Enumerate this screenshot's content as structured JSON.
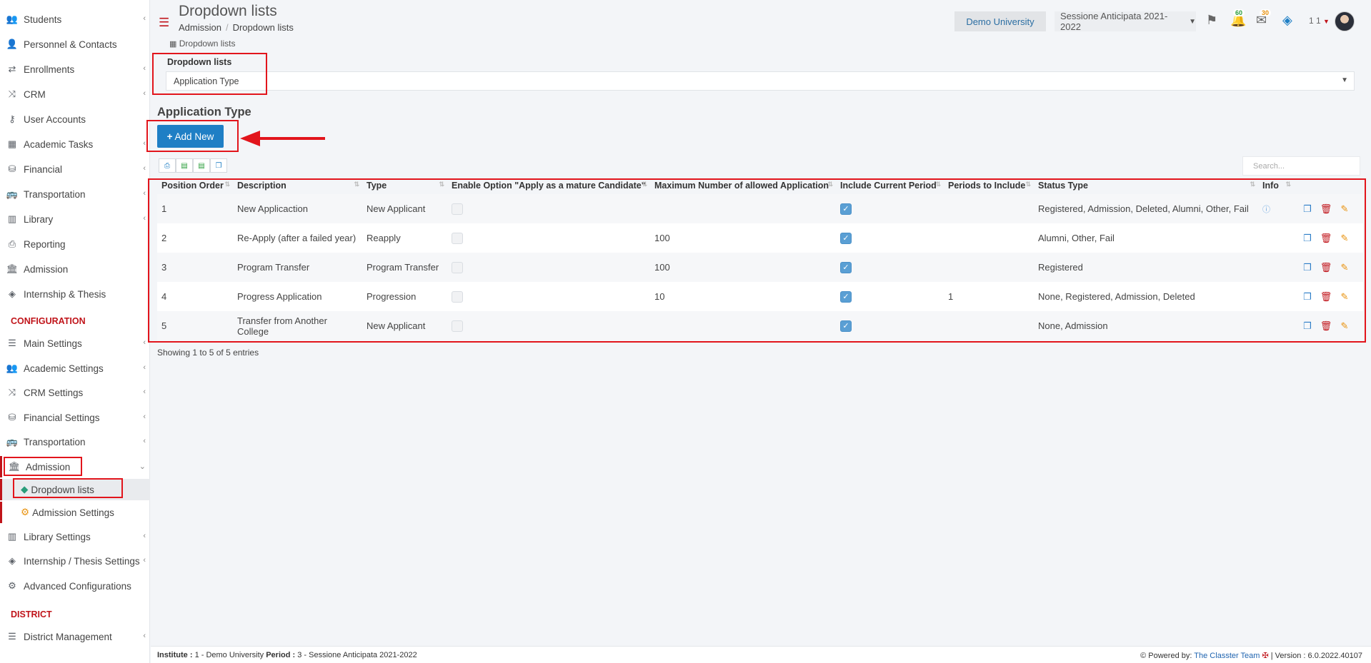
{
  "sidebar": {
    "items": [
      {
        "label": "Students",
        "icon": "students-icon",
        "glyph": "👥"
      },
      {
        "label": "Personnel & Contacts",
        "icon": "personnel-icon",
        "glyph": "👤"
      },
      {
        "label": "Enrollments",
        "icon": "exchange-icon",
        "glyph": "⇄"
      },
      {
        "label": "CRM",
        "icon": "random-icon",
        "glyph": "⤨"
      },
      {
        "label": "User Accounts",
        "icon": "key-icon",
        "glyph": "⚷"
      },
      {
        "label": "Academic Tasks",
        "icon": "grid-icon",
        "glyph": "▦"
      },
      {
        "label": "Financial",
        "icon": "coins-icon",
        "glyph": "⛁"
      },
      {
        "label": "Transportation",
        "icon": "bus-icon",
        "glyph": "🚌"
      },
      {
        "label": "Library",
        "icon": "books-icon",
        "glyph": "▥"
      },
      {
        "label": "Reporting",
        "icon": "print-icon",
        "glyph": "⎙"
      },
      {
        "label": "Admission",
        "icon": "bank-icon",
        "glyph": "🏛"
      },
      {
        "label": "Internship & Thesis",
        "icon": "box-icon",
        "glyph": "◈"
      }
    ],
    "config_title": "CONFIGURATION",
    "config_items": [
      {
        "label": "Main Settings",
        "icon": "sliders-icon",
        "glyph": "☰"
      },
      {
        "label": "Academic Settings",
        "icon": "users-icon",
        "glyph": "👥"
      },
      {
        "label": "CRM Settings",
        "icon": "random-icon",
        "glyph": "⤨"
      },
      {
        "label": "Financial Settings",
        "icon": "coins-icon",
        "glyph": "⛁"
      },
      {
        "label": "Transportation",
        "icon": "bus-icon",
        "glyph": "🚌"
      }
    ],
    "admission_open": {
      "label": "Admission",
      "icon": "bank-icon",
      "glyph": "🏛"
    },
    "admission_sub": [
      {
        "label": "Dropdown lists",
        "icon": "layers-icon",
        "glyph": "◆"
      },
      {
        "label": "Admission Settings",
        "icon": "gears-icon",
        "glyph": "⚙"
      }
    ],
    "config_items2": [
      {
        "label": "Library Settings",
        "icon": "books-icon",
        "glyph": "▥"
      },
      {
        "label": "Internship / Thesis Settings",
        "icon": "box-icon",
        "glyph": "◈"
      },
      {
        "label": "Advanced Configurations",
        "icon": "gears-icon",
        "glyph": "⚙"
      }
    ],
    "district_title": "DISTRICT",
    "district_items": [
      {
        "label": "District Management",
        "icon": "list-icon",
        "glyph": "☰"
      }
    ]
  },
  "header": {
    "title": "Dropdown lists",
    "breadcrumb": [
      "Admission",
      "Dropdown lists"
    ],
    "institution": "Demo University",
    "session": "Sessione Anticipata 2021-2022",
    "notifications_count": "60",
    "messages_count": "30",
    "user": "1 1"
  },
  "main": {
    "tab": "Dropdown lists",
    "field_label": "Dropdown lists",
    "selected_list": "Application Type",
    "section_title": "Application Type",
    "add_button": "Add New",
    "search_placeholder": "Search...",
    "columns": [
      "Position Order",
      "Description",
      "Type",
      "Enable Option \"Apply as a mature Candidate\"",
      "Maximum Number of allowed Application",
      "Include Current Period",
      "Periods to Include",
      "Status Type",
      "Info"
    ],
    "rows": [
      {
        "order": "1",
        "description": "New Applicaction",
        "type": "New Applicant",
        "mature": false,
        "max": "",
        "include": true,
        "periods": "",
        "status": "Registered, Admission, Deleted, Alumni, Other, Fail",
        "info": true
      },
      {
        "order": "2",
        "description": "Re-Apply (after a failed year)",
        "type": "Reapply",
        "mature": false,
        "max": "100",
        "include": true,
        "periods": "",
        "status": "Alumni, Other, Fail",
        "info": false
      },
      {
        "order": "3",
        "description": "Program Transfer",
        "type": "Program Transfer",
        "mature": false,
        "max": "100",
        "include": true,
        "periods": "",
        "status": "Registered",
        "info": false
      },
      {
        "order": "4",
        "description": "Progress Application",
        "type": "Progression",
        "mature": false,
        "max": "10",
        "include": true,
        "periods": "1",
        "status": "None, Registered, Admission, Deleted",
        "info": false
      },
      {
        "order": "5",
        "description": "Transfer from Another College",
        "type": "New Applicant",
        "mature": false,
        "max": "",
        "include": true,
        "periods": "",
        "status": "None, Admission",
        "info": false
      }
    ],
    "entries_text": "Showing 1 to 5 of 5 entries"
  },
  "footer": {
    "institute_label": "Institute :",
    "institute_value": "1 - Demo University",
    "period_label": "Period :",
    "period_value": "3 - Sessione Anticipata 2021-2022",
    "powered_label": "Powered by:",
    "powered_link": "The Classter Team",
    "version": "| Version : 6.0.2022.40107"
  },
  "colors": {
    "accent": "#1f7fc5",
    "brand_red": "#c0141a",
    "highlight_box": "#e2151c"
  }
}
